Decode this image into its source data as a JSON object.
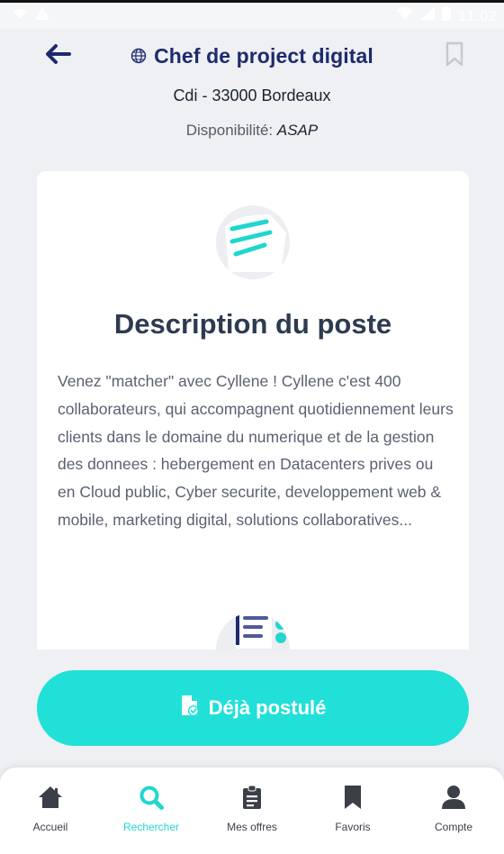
{
  "status_bar": {
    "time": "11:02",
    "icons": [
      "notification-icon",
      "warning-icon",
      "wifi-icon",
      "signal-icon",
      "battery-icon"
    ]
  },
  "header": {
    "back_icon": "arrow-left-icon",
    "title": "Chef de project digital",
    "title_icon": "globe-icon",
    "bookmark_icon": "bookmark-outline-icon",
    "contract": "Cdi - 33000 Bordeaux",
    "availability_label": "Disponibilité:",
    "availability_value": "ASAP"
  },
  "card": {
    "icon": "document-lines-icon",
    "title": "Description du poste",
    "body": "Venez \"matcher\" avec Cyllene ! Cyllene c'est 400 collaborateurs, qui accompagnent quotidiennement leurs clients dans le domaine du numerique et de la gestion des donnees : hebergement en Datacenters prives ou en Cloud public, Cyber securite, developpement web & mobile, marketing digital, solutions collaboratives...",
    "next_icon": "checklist-icon"
  },
  "apply_button": {
    "label": "Déjà postulé",
    "icon": "file-check-icon"
  },
  "nav": {
    "items": [
      {
        "label": "Accueil",
        "icon": "home-icon"
      },
      {
        "label": "Rechercher",
        "icon": "search-icon"
      },
      {
        "label": "Mes offres",
        "icon": "clipboard-icon"
      },
      {
        "label": "Favoris",
        "icon": "bookmark-icon"
      },
      {
        "label": "Compte",
        "icon": "user-icon"
      }
    ],
    "active_index": 1
  },
  "colors": {
    "primary_navy": "#1e2a6e",
    "accent_teal": "#21e0d8",
    "background": "#eef0f3",
    "card": "#ffffff"
  }
}
